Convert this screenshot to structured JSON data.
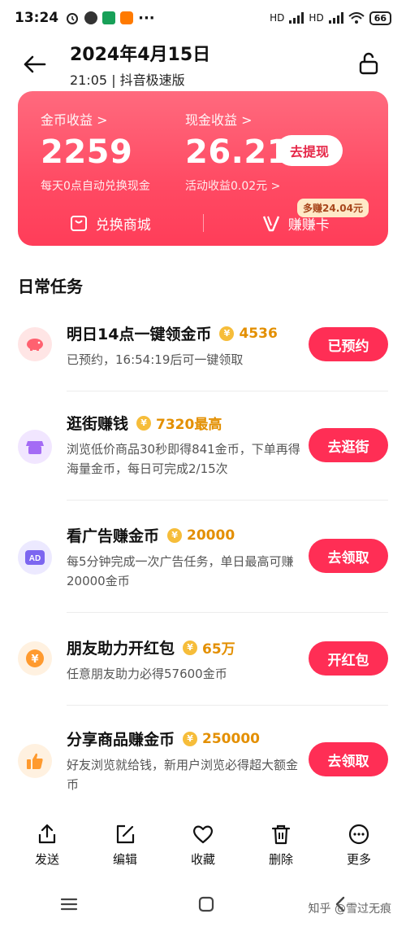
{
  "status_bar": {
    "time": "13:24",
    "network_1": "HD",
    "network_2": "HD",
    "battery": "66"
  },
  "header": {
    "title": "2024年4月15日",
    "subtitle": "21:05 | 抖音极速版"
  },
  "earnings": {
    "coin_label": "金币收益 >",
    "coin_value": "2259",
    "coin_note": "每天0点自动兑换现金",
    "cash_label": "现金收益 >",
    "cash_value": "26.21",
    "cash_note": "活动收益0.02元 >",
    "withdraw_label": "去提现",
    "shop_label": "兑换商城",
    "card_label": "赚赚卡",
    "card_badge": "多赚24.04元"
  },
  "section_title": "日常任务",
  "tasks": [
    {
      "title": "明日14点一键领金币",
      "reward": "4536",
      "desc": "已预约，16:54:19后可一键领取",
      "button": "已预约",
      "icon": "piggy-bank-icon",
      "icon_bg": "#ffe5e5"
    },
    {
      "title": "逛街赚钱",
      "reward": "7320最高",
      "desc": "浏览低价商品30秒即得841金币，下单再得海量金币，每日可完成2/15次",
      "button": "去逛街",
      "icon": "shop-icon",
      "icon_bg": "#f1e6ff"
    },
    {
      "title": "看广告赚金币",
      "reward": "20000",
      "desc": "每5分钟完成一次广告任务，单日最高可赚20000金币",
      "button": "去领取",
      "icon": "ad-icon",
      "icon_bg": "#ece9ff"
    },
    {
      "title": "朋友助力开红包",
      "reward": "65万",
      "desc": "任意朋友助力必得57600金币",
      "button": "开红包",
      "icon": "yuan-coin-icon",
      "icon_bg": "#fff1e0"
    },
    {
      "title": "分享商品赚金币",
      "reward": "250000",
      "desc": "好友浏览就给钱，新用户浏览必得超大额金币",
      "button": "去领取",
      "icon": "thumbs-up-icon",
      "icon_bg": "#fff1e0"
    }
  ],
  "share_bar": {
    "send": "发送",
    "edit": "编辑",
    "favorite": "收藏",
    "delete": "删除",
    "more": "更多"
  },
  "watermark": "知乎 @雪过无痕",
  "colors": {
    "accent": "#ff2e55",
    "card_gradient_top": "#ff6a7e",
    "reward": "#e38f00"
  }
}
